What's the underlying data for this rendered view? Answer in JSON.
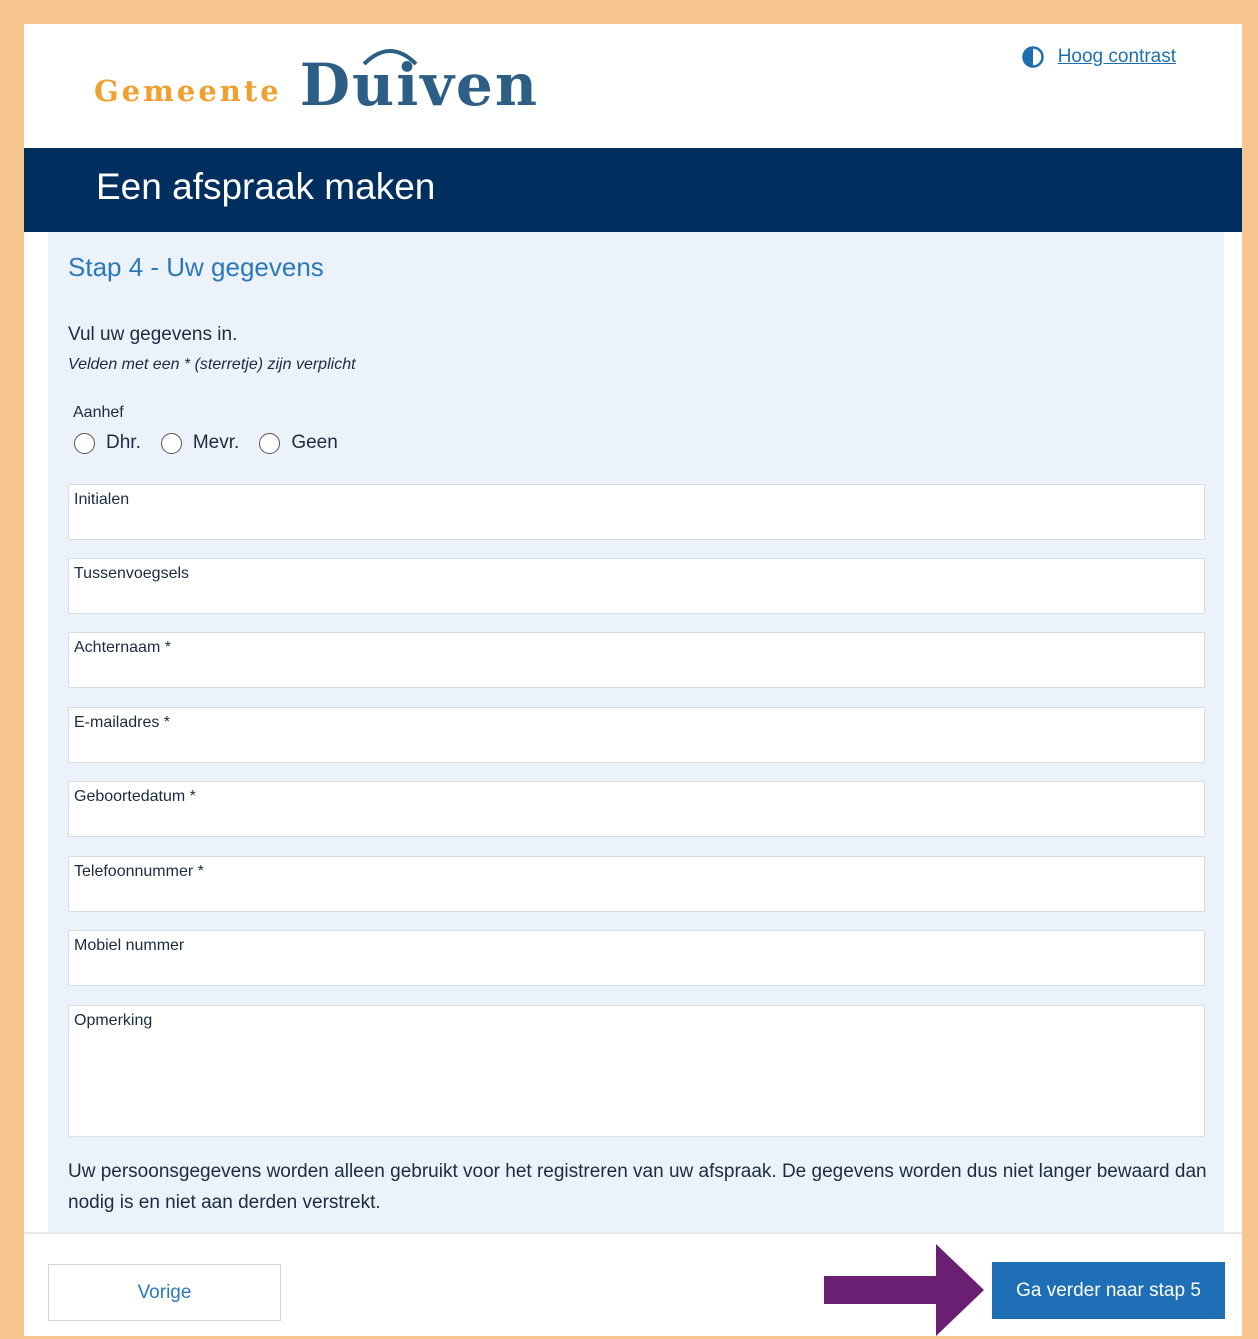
{
  "header": {
    "logo_small": "Gemeente",
    "logo_big": "Duiven",
    "contrast_label": "Hoog contrast"
  },
  "banner": {
    "title": "Een afspraak maken"
  },
  "form": {
    "step_title": "Stap 4 - Uw gegevens",
    "intro": "Vul uw gegevens in.",
    "required_note": "Velden met een * (sterretje) zijn verplicht",
    "aanhef_label": "Aanhef",
    "aanhef_options": [
      "Dhr.",
      "Mevr.",
      "Geen"
    ],
    "fields": [
      {
        "label": "Initialen"
      },
      {
        "label": "Tussenvoegsels"
      },
      {
        "label": "Achternaam *"
      },
      {
        "label": "E-mailadres *"
      },
      {
        "label": "Geboortedatum *"
      },
      {
        "label": "Telefoonnummer *"
      },
      {
        "label": "Mobiel nummer"
      },
      {
        "label": "Opmerking"
      }
    ],
    "privacy": "Uw persoonsgegevens worden alleen gebruikt voor het registreren van uw afspraak. De gegevens worden dus niet langer bewaard dan nodig is en niet aan derden verstrekt."
  },
  "footer": {
    "prev_label": "Vorige",
    "next_label": "Ga verder naar stap 5"
  },
  "colors": {
    "border": "#f7c68f",
    "banner": "#002f5f",
    "accent": "#2b78ba",
    "button": "#1f6fb6",
    "arrow": "#6b1f73",
    "logo_orange": "#f0a030",
    "logo_blue": "#2d5f86"
  }
}
